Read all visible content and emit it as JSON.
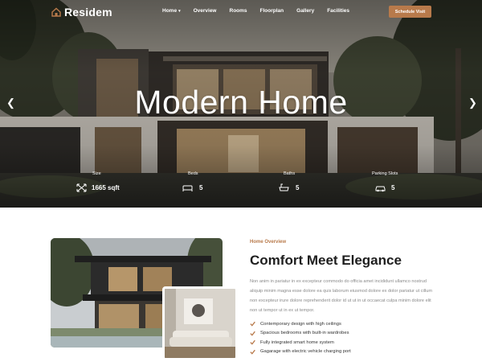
{
  "brand": {
    "name": "Residem",
    "accent": "#b87a4b"
  },
  "nav": {
    "items": [
      {
        "label": "Home",
        "has_dropdown": true
      },
      {
        "label": "Overview"
      },
      {
        "label": "Rooms"
      },
      {
        "label": "Floorplan"
      },
      {
        "label": "Gallery"
      },
      {
        "label": "Facilities"
      }
    ],
    "cta_label": "Schedule Visit"
  },
  "hero": {
    "title": "Modern Home",
    "prev_icon": "chevron-left-icon",
    "next_icon": "chevron-right-icon",
    "stats": [
      {
        "label": "Size",
        "value": "1665 sqft",
        "icon": "expand-arrows-icon"
      },
      {
        "label": "Beds",
        "value": "5",
        "icon": "bed-icon"
      },
      {
        "label": "Baths",
        "value": "5",
        "icon": "bathtub-icon"
      },
      {
        "label": "Parking Slots",
        "value": "5",
        "icon": "car-icon"
      }
    ]
  },
  "overview": {
    "kicker": "Home Overview",
    "heading": "Comfort Meet Elegance",
    "paragraph": "Non anim in pariatur in ex excepteur commodo do officia amet incididunt ullamco nostrud aliquip minim magna esse dolore ea quis laborum eiusmod dolore ex dolor pariatur ut cillum non excepteur irure dolore reprehenderit dolor id ut ut in ut occaecat culpa minim dolore elit non ut tempor ut in ex ut tempor.",
    "features": [
      "Contemporary design with high ceilings",
      "Spacious bedrooms with built-in wardrobes",
      "Fully integrated smart home system",
      "Gagarage with electric vehicle charging port"
    ]
  }
}
